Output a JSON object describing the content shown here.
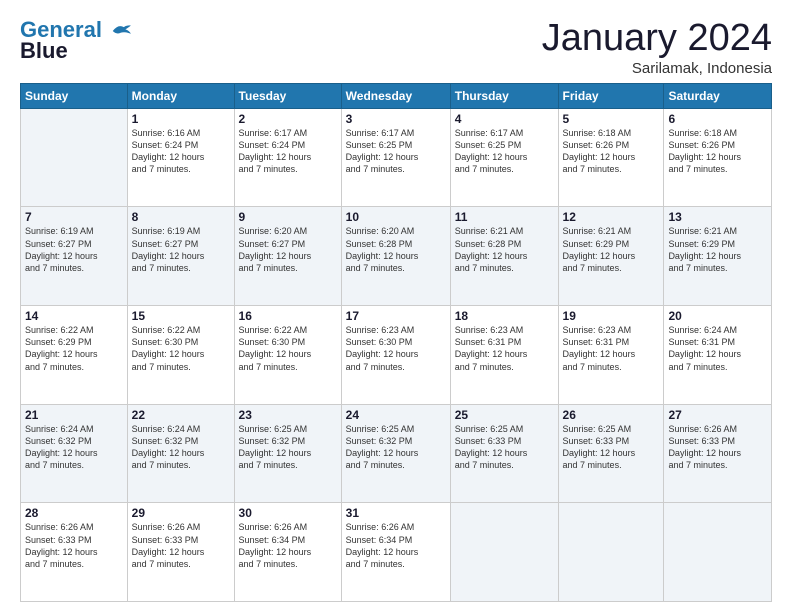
{
  "logo": {
    "line1": "General",
    "line2": "Blue"
  },
  "header": {
    "month": "January 2024",
    "location": "Sarilamak, Indonesia"
  },
  "weekdays": [
    "Sunday",
    "Monday",
    "Tuesday",
    "Wednesday",
    "Thursday",
    "Friday",
    "Saturday"
  ],
  "weeks": [
    [
      {
        "day": "",
        "info": ""
      },
      {
        "day": "1",
        "info": "Sunrise: 6:16 AM\nSunset: 6:24 PM\nDaylight: 12 hours\nand 7 minutes."
      },
      {
        "day": "2",
        "info": "Sunrise: 6:17 AM\nSunset: 6:24 PM\nDaylight: 12 hours\nand 7 minutes."
      },
      {
        "day": "3",
        "info": "Sunrise: 6:17 AM\nSunset: 6:25 PM\nDaylight: 12 hours\nand 7 minutes."
      },
      {
        "day": "4",
        "info": "Sunrise: 6:17 AM\nSunset: 6:25 PM\nDaylight: 12 hours\nand 7 minutes."
      },
      {
        "day": "5",
        "info": "Sunrise: 6:18 AM\nSunset: 6:26 PM\nDaylight: 12 hours\nand 7 minutes."
      },
      {
        "day": "6",
        "info": "Sunrise: 6:18 AM\nSunset: 6:26 PM\nDaylight: 12 hours\nand 7 minutes."
      }
    ],
    [
      {
        "day": "7",
        "info": "Sunrise: 6:19 AM\nSunset: 6:27 PM\nDaylight: 12 hours\nand 7 minutes."
      },
      {
        "day": "8",
        "info": "Sunrise: 6:19 AM\nSunset: 6:27 PM\nDaylight: 12 hours\nand 7 minutes."
      },
      {
        "day": "9",
        "info": "Sunrise: 6:20 AM\nSunset: 6:27 PM\nDaylight: 12 hours\nand 7 minutes."
      },
      {
        "day": "10",
        "info": "Sunrise: 6:20 AM\nSunset: 6:28 PM\nDaylight: 12 hours\nand 7 minutes."
      },
      {
        "day": "11",
        "info": "Sunrise: 6:21 AM\nSunset: 6:28 PM\nDaylight: 12 hours\nand 7 minutes."
      },
      {
        "day": "12",
        "info": "Sunrise: 6:21 AM\nSunset: 6:29 PM\nDaylight: 12 hours\nand 7 minutes."
      },
      {
        "day": "13",
        "info": "Sunrise: 6:21 AM\nSunset: 6:29 PM\nDaylight: 12 hours\nand 7 minutes."
      }
    ],
    [
      {
        "day": "14",
        "info": "Sunrise: 6:22 AM\nSunset: 6:29 PM\nDaylight: 12 hours\nand 7 minutes."
      },
      {
        "day": "15",
        "info": "Sunrise: 6:22 AM\nSunset: 6:30 PM\nDaylight: 12 hours\nand 7 minutes."
      },
      {
        "day": "16",
        "info": "Sunrise: 6:22 AM\nSunset: 6:30 PM\nDaylight: 12 hours\nand 7 minutes."
      },
      {
        "day": "17",
        "info": "Sunrise: 6:23 AM\nSunset: 6:30 PM\nDaylight: 12 hours\nand 7 minutes."
      },
      {
        "day": "18",
        "info": "Sunrise: 6:23 AM\nSunset: 6:31 PM\nDaylight: 12 hours\nand 7 minutes."
      },
      {
        "day": "19",
        "info": "Sunrise: 6:23 AM\nSunset: 6:31 PM\nDaylight: 12 hours\nand 7 minutes."
      },
      {
        "day": "20",
        "info": "Sunrise: 6:24 AM\nSunset: 6:31 PM\nDaylight: 12 hours\nand 7 minutes."
      }
    ],
    [
      {
        "day": "21",
        "info": "Sunrise: 6:24 AM\nSunset: 6:32 PM\nDaylight: 12 hours\nand 7 minutes."
      },
      {
        "day": "22",
        "info": "Sunrise: 6:24 AM\nSunset: 6:32 PM\nDaylight: 12 hours\nand 7 minutes."
      },
      {
        "day": "23",
        "info": "Sunrise: 6:25 AM\nSunset: 6:32 PM\nDaylight: 12 hours\nand 7 minutes."
      },
      {
        "day": "24",
        "info": "Sunrise: 6:25 AM\nSunset: 6:32 PM\nDaylight: 12 hours\nand 7 minutes."
      },
      {
        "day": "25",
        "info": "Sunrise: 6:25 AM\nSunset: 6:33 PM\nDaylight: 12 hours\nand 7 minutes."
      },
      {
        "day": "26",
        "info": "Sunrise: 6:25 AM\nSunset: 6:33 PM\nDaylight: 12 hours\nand 7 minutes."
      },
      {
        "day": "27",
        "info": "Sunrise: 6:26 AM\nSunset: 6:33 PM\nDaylight: 12 hours\nand 7 minutes."
      }
    ],
    [
      {
        "day": "28",
        "info": "Sunrise: 6:26 AM\nSunset: 6:33 PM\nDaylight: 12 hours\nand 7 minutes."
      },
      {
        "day": "29",
        "info": "Sunrise: 6:26 AM\nSunset: 6:33 PM\nDaylight: 12 hours\nand 7 minutes."
      },
      {
        "day": "30",
        "info": "Sunrise: 6:26 AM\nSunset: 6:34 PM\nDaylight: 12 hours\nand 7 minutes."
      },
      {
        "day": "31",
        "info": "Sunrise: 6:26 AM\nSunset: 6:34 PM\nDaylight: 12 hours\nand 7 minutes."
      },
      {
        "day": "",
        "info": ""
      },
      {
        "day": "",
        "info": ""
      },
      {
        "day": "",
        "info": ""
      }
    ]
  ]
}
